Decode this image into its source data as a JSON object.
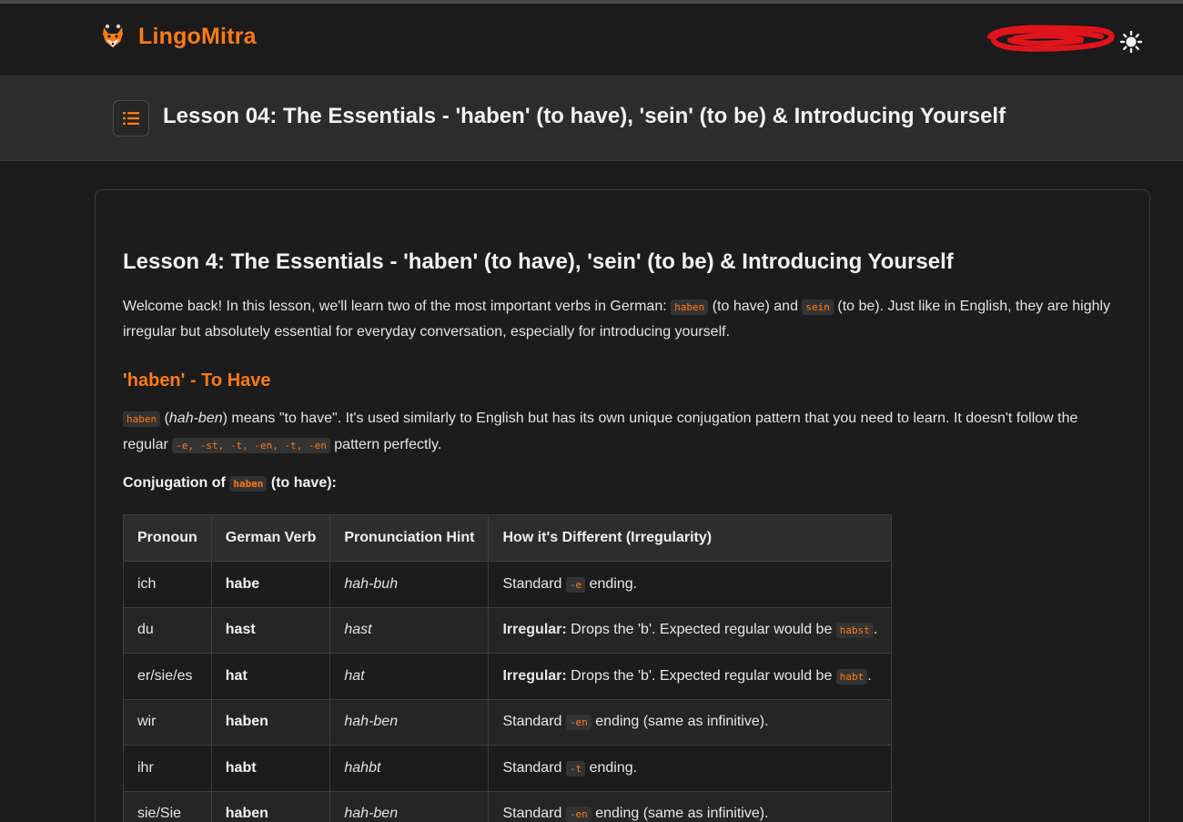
{
  "app": {
    "brand_name": "LingoMitra",
    "accent_color": "#ff7a1a",
    "theme_icon": "sun-icon"
  },
  "lesson_header": {
    "title": "Lesson 04: The Essentials - 'haben' (to have), 'sein' (to be) & Introducing Yourself",
    "toc_icon": "list-icon"
  },
  "content": {
    "heading": "Lesson 4: The Essentials - 'haben' (to have), 'sein' (to be) & Introducing Yourself",
    "intro": {
      "t1": "Welcome back! In this lesson, we'll learn two of the most important verbs in German: ",
      "c1": "haben",
      "t2": " (to have) and ",
      "c2": "sein",
      "t3": " (to be). Just like in English, they are highly irregular but absolutely essential for everyday conversation, especially for introducing yourself."
    },
    "section_haben": {
      "heading": "'haben' - To Have",
      "p_code": "haben",
      "p_open": " (",
      "p_pron": "hah-ben",
      "p_text": ") means \"to have\". It's used similarly to English but has its own unique conjugation pattern that you need to learn. It doesn't follow the regular ",
      "p_code2": "-e, -st, -t, -en, -t, -en",
      "p_end": " pattern perfectly.",
      "conj_label_1": "Conjugation of ",
      "conj_code": "haben",
      "conj_label_2": " (to have):"
    },
    "table": {
      "headers": [
        "Pronoun",
        "German Verb",
        "Pronunciation Hint",
        "How it's Different (Irregularity)"
      ],
      "rows": [
        {
          "pronoun": "ich",
          "verb": "habe",
          "hint": "hah-buh",
          "bold": "",
          "pre": "Standard ",
          "code": "-e",
          "post": " ending."
        },
        {
          "pronoun": "du",
          "verb": "hast",
          "hint": "hast",
          "bold": "Irregular:",
          "pre": " Drops the 'b'. Expected regular would be ",
          "code": "habst",
          "post": "."
        },
        {
          "pronoun": "er/sie/es",
          "verb": "hat",
          "hint": "hat",
          "bold": "Irregular:",
          "pre": " Drops the 'b'. Expected regular would be ",
          "code": "habt",
          "post": "."
        },
        {
          "pronoun": "wir",
          "verb": "haben",
          "hint": "hah-ben",
          "bold": "",
          "pre": "Standard ",
          "code": "-en",
          "post": " ending (same as infinitive)."
        },
        {
          "pronoun": "ihr",
          "verb": "habt",
          "hint": "hahbt",
          "bold": "",
          "pre": "Standard ",
          "code": "-t",
          "post": " ending."
        },
        {
          "pronoun": "sie/Sie",
          "verb": "haben",
          "hint": "hah-ben",
          "bold": "",
          "pre": "Standard ",
          "code": "-en",
          "post": " ending (same as infinitive)."
        }
      ]
    }
  }
}
